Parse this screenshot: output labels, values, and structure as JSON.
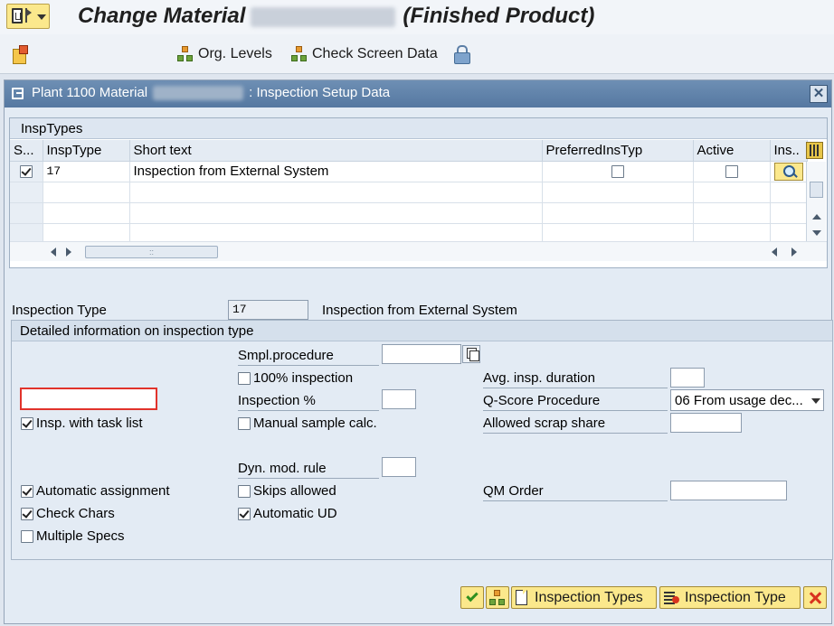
{
  "window": {
    "title_prefix": "Change Material",
    "title_suffix": "(Finished Product)"
  },
  "toolbar": {
    "org_levels_label": "Org. Levels",
    "check_screen_data_label": "Check Screen Data"
  },
  "dialog": {
    "title_prefix": "Plant 1100 Material",
    "title_suffix": ": Inspection Setup Data",
    "close_symbol": "✕"
  },
  "insp_table": {
    "tab_label": "InspTypes",
    "columns": [
      "S...",
      "InspType",
      "Short text",
      "PreferredInsTyp",
      "Active",
      "Ins.."
    ],
    "rows": [
      {
        "selected": true,
        "insp_type": "17",
        "short_text": "Inspection from External System",
        "preferred": false,
        "active": false
      }
    ]
  },
  "inspection_type": {
    "label": "Inspection Type",
    "value": "17",
    "description": "Inspection from External System"
  },
  "detail": {
    "header": "Detailed information on inspection type",
    "smpl_procedure_label": "Smpl.procedure",
    "smpl_procedure_value": "",
    "pct100_label": "100% inspection",
    "pct100_checked": false,
    "inspection_pct_label": "Inspection %",
    "inspection_pct_value": "",
    "insp_task_list_label": "Insp. with task list",
    "insp_task_list_checked": true,
    "manual_sample_label": "Manual sample calc.",
    "manual_sample_checked": false,
    "dyn_mod_rule_label": "Dyn. mod. rule",
    "dyn_mod_rule_value": "",
    "auto_assign_label": "Automatic assignment",
    "auto_assign_checked": true,
    "skips_allowed_label": "Skips allowed",
    "skips_allowed_checked": false,
    "check_chars_label": "Check Chars",
    "check_chars_checked": true,
    "auto_ud_label": "Automatic UD",
    "auto_ud_checked": true,
    "multiple_specs_label": "Multiple Specs",
    "multiple_specs_checked": false,
    "avg_duration_label": "Avg. insp. duration",
    "avg_duration_value": "",
    "qscore_label": "Q-Score Procedure",
    "qscore_value": "06 From usage dec...",
    "scrap_share_label": "Allowed scrap share",
    "scrap_share_value": "",
    "qm_order_label": "QM Order",
    "qm_order_value": ""
  },
  "buttons": {
    "inspection_types_label": "Inspection Types",
    "inspection_type_label": "Inspection Type"
  },
  "icons": [
    "menu-icon",
    "clipboard-icon",
    "hierarchy-icon",
    "check-screen-icon",
    "lock-icon",
    "dialog-icon",
    "close-icon",
    "column-config-icon",
    "detail-icon",
    "copy-icon",
    "dropdown-arrow-icon",
    "check-icon",
    "hierarchy-icon",
    "document-icon",
    "list-delete-icon",
    "cancel-icon"
  ],
  "colors": {
    "accent": "#fbe88c",
    "header": "#5f82ab",
    "highlight": "#e1332b"
  }
}
